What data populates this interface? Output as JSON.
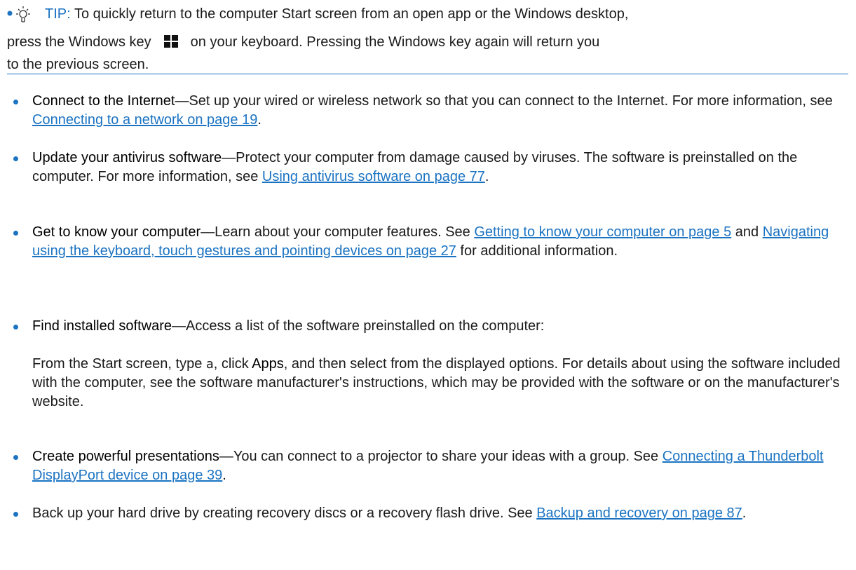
{
  "tip": {
    "label": "TIP:",
    "line1": "To quickly return to the computer Start screen from an open app or the Windows desktop,",
    "line2_before": "press the Windows key",
    "line2_after": "on your keyboard. Pressing the Windows key again will return you",
    "line3": "to the previous screen."
  },
  "items": [
    {
      "term": "Connect to the Internet",
      "text1": "—Set up your wired or wireless network so that you can connect to the Internet. For more information, see ",
      "link1": "Connecting to a network on page 19",
      "text2": "."
    },
    {
      "term": "Update your antivirus software",
      "text1": "—Protect your computer from damage caused by viruses. The software is preinstalled on the computer. For more information, see ",
      "link1": "Using antivirus software on page 77",
      "text2": "."
    },
    {
      "term": "Get to know your computer",
      "text1": "—Learn about your computer features. See ",
      "link1": "Getting to know your computer on page 5",
      "text2": " and ",
      "link2": "Navigating using the keyboard, touch gestures and pointing devices on page 27",
      "text3": " for additional information."
    },
    {
      "term": "Find installed software",
      "text1": "—Access a list of the software preinstalled on the computer:",
      "sub_before": "From the Start screen, type ",
      "sub_code": "a",
      "sub_mid": ", click ",
      "sub_bold": "Apps",
      "sub_after": ", and then select from the displayed options. For details about using the software included with the computer, see the software manufacturer's instructions, which may be provided with the software or on the manufacturer's website."
    },
    {
      "term": "Create powerful presentations",
      "text1": "—You can connect to a projector to share your ideas with a group. See ",
      "link1": "Connecting a Thunderbolt DisplayPort device on page 39",
      "text2": "."
    },
    {
      "text1": "Back up your hard drive by creating recovery discs or a recovery flash drive. See ",
      "link1": "Backup and recovery on page 87",
      "text2": "."
    }
  ]
}
